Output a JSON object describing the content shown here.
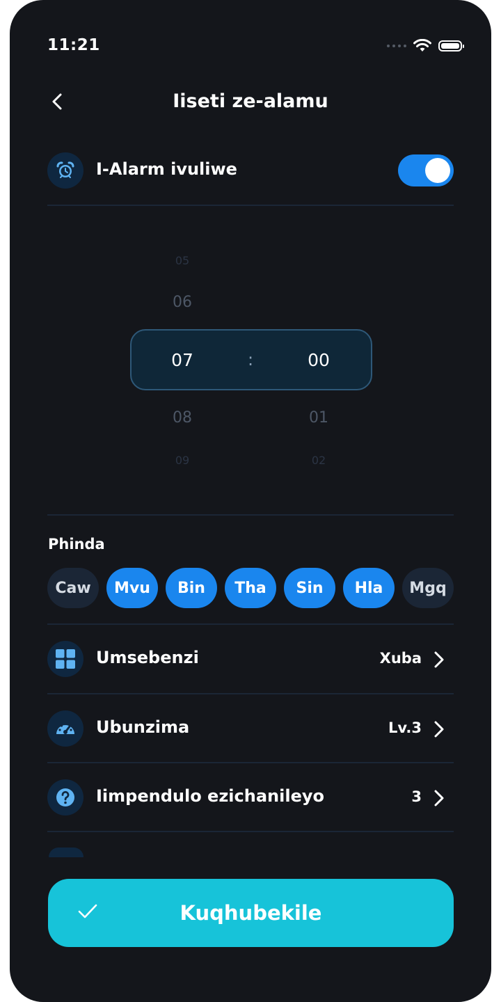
{
  "status_bar": {
    "time": "11:21"
  },
  "header": {
    "title": "Iiseti ze-alamu"
  },
  "alarm_toggle": {
    "label": "I-Alarm ivuliwe",
    "enabled": true,
    "accent": "#1a86ee"
  },
  "time_picker": {
    "hours": {
      "far_above": "05",
      "above": "06",
      "selected": "07",
      "below": "08",
      "far_below": "09"
    },
    "minutes": {
      "selected": "00",
      "below": "01",
      "far_below": "02"
    },
    "separator": ":"
  },
  "repeat": {
    "label": "Phinda",
    "days": [
      {
        "label": "Caw",
        "selected": false
      },
      {
        "label": "Mvu",
        "selected": true
      },
      {
        "label": "Bin",
        "selected": true
      },
      {
        "label": "Tha",
        "selected": true
      },
      {
        "label": "Sin",
        "selected": true
      },
      {
        "label": "Hla",
        "selected": true
      },
      {
        "label": "Mgq",
        "selected": false
      }
    ]
  },
  "settings": [
    {
      "icon": "grid-icon",
      "label": "Umsebenzi",
      "value": "Xuba"
    },
    {
      "icon": "speedometer-icon",
      "label": "Ubunzima",
      "value": "Lv.3"
    },
    {
      "icon": "question-icon",
      "label": "Iimpendulo ezichanileyo",
      "value": "3"
    }
  ],
  "cta": {
    "label": "Kuqhubekile",
    "color": "#17c3d9"
  }
}
